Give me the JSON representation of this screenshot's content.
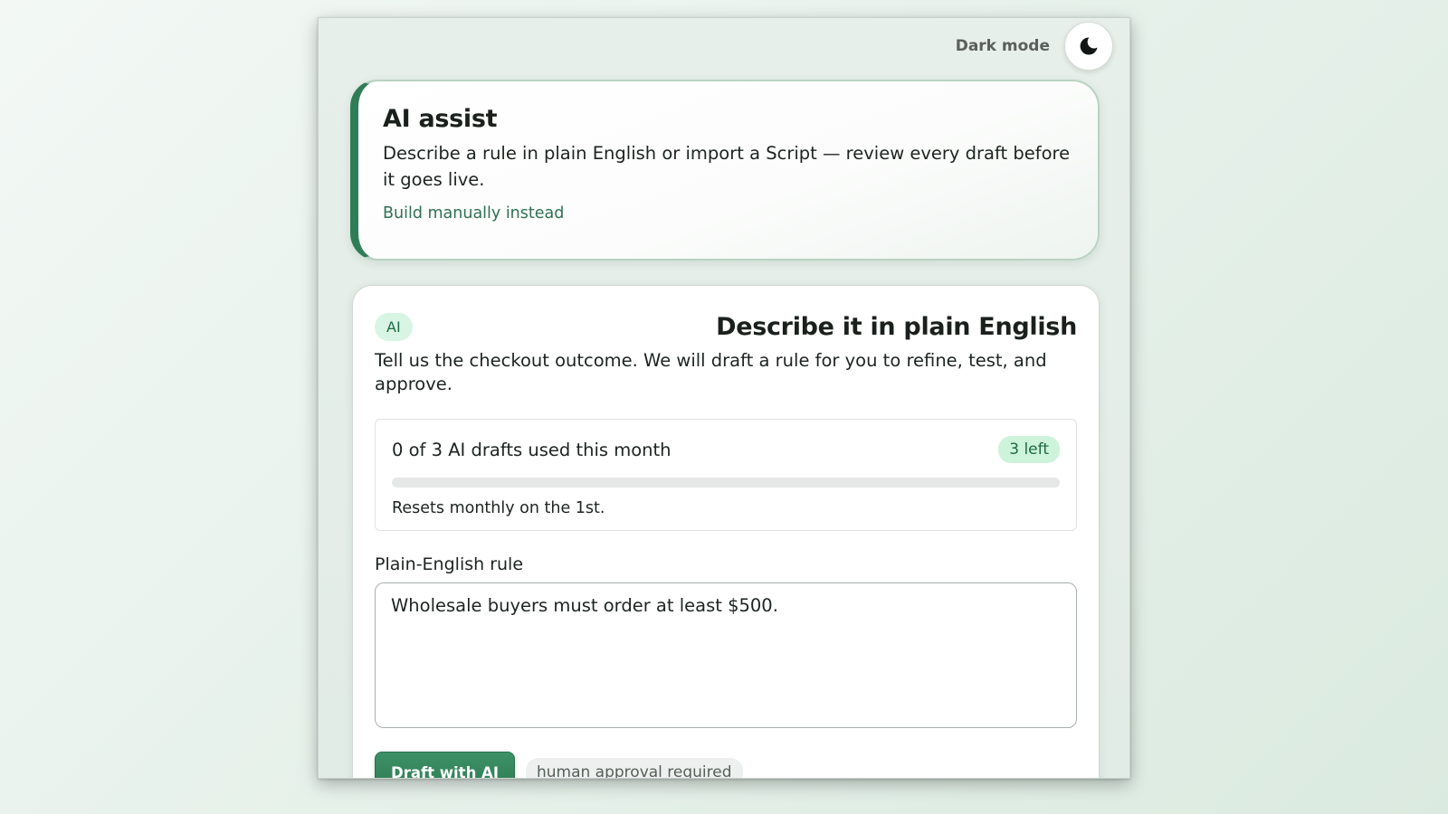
{
  "topbar": {
    "dark_mode_label": "Dark mode",
    "dark_mode_icon": "moon-icon"
  },
  "assist": {
    "title": "AI assist",
    "description": "Describe a rule in plain English or import a Script — review every draft before it goes live.",
    "manual_link": "Build manually instead"
  },
  "main": {
    "chip": "AI",
    "title": "Describe it in plain English",
    "description": "Tell us the checkout outcome. We will draft a rule for you to refine, test, and approve.",
    "quota": {
      "used_text": "0 of 3 AI drafts used this month",
      "left_badge": "3 left",
      "used_fraction": 0,
      "reset_note": "Resets monthly on the 1st."
    },
    "field_label": "Plain-English rule",
    "rule_value": "Wholesale buyers must order at least $500.",
    "draft_button": "Draft with AI",
    "approval_note": "human approval required"
  },
  "colors": {
    "accent": "#2f7d57",
    "chip_bg": "#d8f5e3",
    "page_bg": "#e6f1ea"
  }
}
